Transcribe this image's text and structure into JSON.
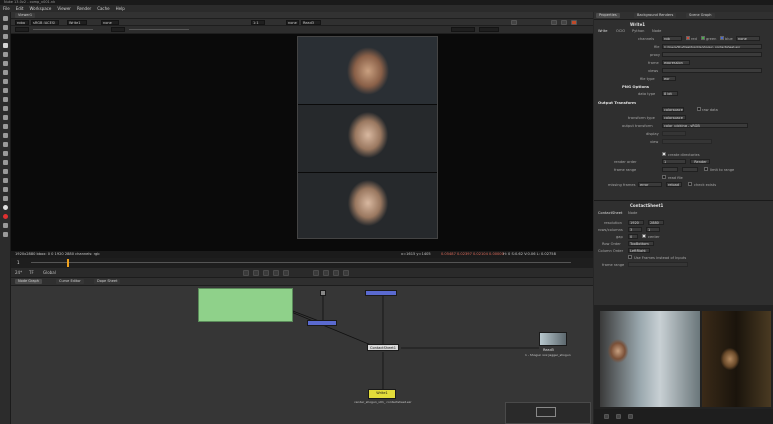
{
  "app": {
    "window_title": "Nuke 13.0v2 - comp_v001.nk",
    "accent": "#f0a21e",
    "viewer_bg": "#0a0a0a",
    "panel_bg": "#2f2f2f"
  },
  "menu": [
    "File",
    "Edit",
    "Workspace",
    "Viewer",
    "Render",
    "Cache",
    "Help"
  ],
  "viewer": {
    "tab_label": "Viewer1",
    "colorspace": "sRGB (ACES)",
    "channel": "rgba",
    "input_a": "Write1",
    "input_b": "none",
    "input_c": "Read3",
    "zoom": "1:1",
    "status": "1920x2880 bbox: 0 0 1920 2880 channels: rgb",
    "status_right": "x=1615 y=1405",
    "pixel_values": "0.05487 0.02397 0.02104 0.00000",
    "hsv": "H: 0 S:0.62 V:0.06 L: 0.02758",
    "frame": "1"
  },
  "transport": {
    "fps_label": "24*",
    "tc_label": "TF",
    "mode": "Global"
  },
  "node_tabs": [
    "Node Graph",
    "Curve Editor",
    "Dope Sheet"
  ],
  "nodes": {
    "crop": "ContactSheet1",
    "merge": "Merge1",
    "read5": "Read5",
    "read5_sub": "1 - Shogun xxx Jagger_shogun",
    "write": "Write1",
    "write_sub": "render_shogun_v01_ contactsheet.exr"
  },
  "props_tabs": [
    "Properties",
    "Background Renders",
    "Scene Graph"
  ],
  "write_panel": {
    "node_name": "Write1",
    "tabs": [
      "Write",
      "OCIO",
      "Python",
      "Node"
    ],
    "channels_label": "channels",
    "channels_value": "rgb",
    "red": "red",
    "green": "green",
    "blue": "blue",
    "none": "none",
    "file_label": "file",
    "file_value": "C:/Users/Stu/Desktop/CG/shogun_contactsheet.exr",
    "proxy_label": "proxy",
    "frame_label": "frame",
    "frame_value": "expression",
    "views_label": "views",
    "file_type_label": "file type",
    "file_type_value": "exr",
    "png_header": "PNG Options",
    "data_type_label": "data type",
    "data_type_value": "8 bit",
    "output_header": "Output Transform",
    "colorspace_mode": "colorspace",
    "view_label": "view",
    "raw_data_label": "raw data",
    "transform_type_label": "transform type",
    "transform_type_value": "colorspace",
    "output_transform_label": "output transform",
    "output_transform_value": "color_picking - sRGB",
    "display_label": "display",
    "create_dirs": "create directories",
    "render_order_label": "render order",
    "render_order_value": "1",
    "render_btn": "Render",
    "frame_range_label": "frame range",
    "limit_range": "limit to range",
    "read_file": "read file",
    "missing_frames_label": "missing frames",
    "missing_frames_value": "error",
    "reload": "reload",
    "check_exists": "check exists"
  },
  "contact_panel": {
    "node_name": "ContactSheet1",
    "tabs": [
      "ContactSheet",
      "Node"
    ],
    "resolution_label": "resolution",
    "res_w": "1920",
    "res_h": "2880",
    "rows_label": "rows/columns",
    "rows": "3",
    "cols": "1",
    "gap_label": "gap",
    "gap": "0",
    "center": "center",
    "roworder_label": "Row Order",
    "roworder_value": "TopBottom",
    "colorder_label": "Column Order",
    "colorder_value": "LeftRight",
    "use_frames": "Use Frames instead of Inputs",
    "frame_range_label": "frame range"
  }
}
